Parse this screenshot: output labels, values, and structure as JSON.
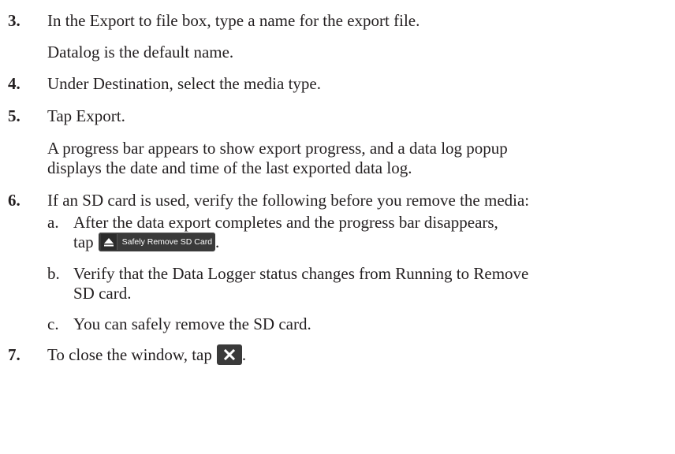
{
  "steps": [
    {
      "num": "3.",
      "lines": [
        "In the Export to file box, type a name for the export file.",
        "Datalog is the default name."
      ]
    },
    {
      "num": "4.",
      "lines": [
        "Under Destination, select the media type."
      ]
    },
    {
      "num": "5.",
      "lines": [
        "Tap Export.",
        "A progress bar appears to show export progress, and a data log popup",
        "displays the date and time of the last exported data log."
      ]
    },
    {
      "num": "6.",
      "lines": [
        "If an SD card is used, verify the following before you remove the media:"
      ]
    },
    {
      "num": "7.",
      "lines": [
        "To close the window, tap",
        "."
      ]
    }
  ],
  "substeps": [
    {
      "letter": "a.",
      "lines": [
        "After the data export completes and the progress bar disappears,",
        "tap",
        "."
      ]
    },
    {
      "letter": "b.",
      "lines": [
        "Verify that the Data Logger status changes from Running to Remove",
        "SD card."
      ]
    },
    {
      "letter": "c.",
      "lines": [
        "You can safely remove the SD card."
      ]
    }
  ],
  "sd_button": {
    "label": "Safely Remove SD Card",
    "icon": "eject-icon"
  },
  "close_button": {
    "icon": "close-icon"
  }
}
